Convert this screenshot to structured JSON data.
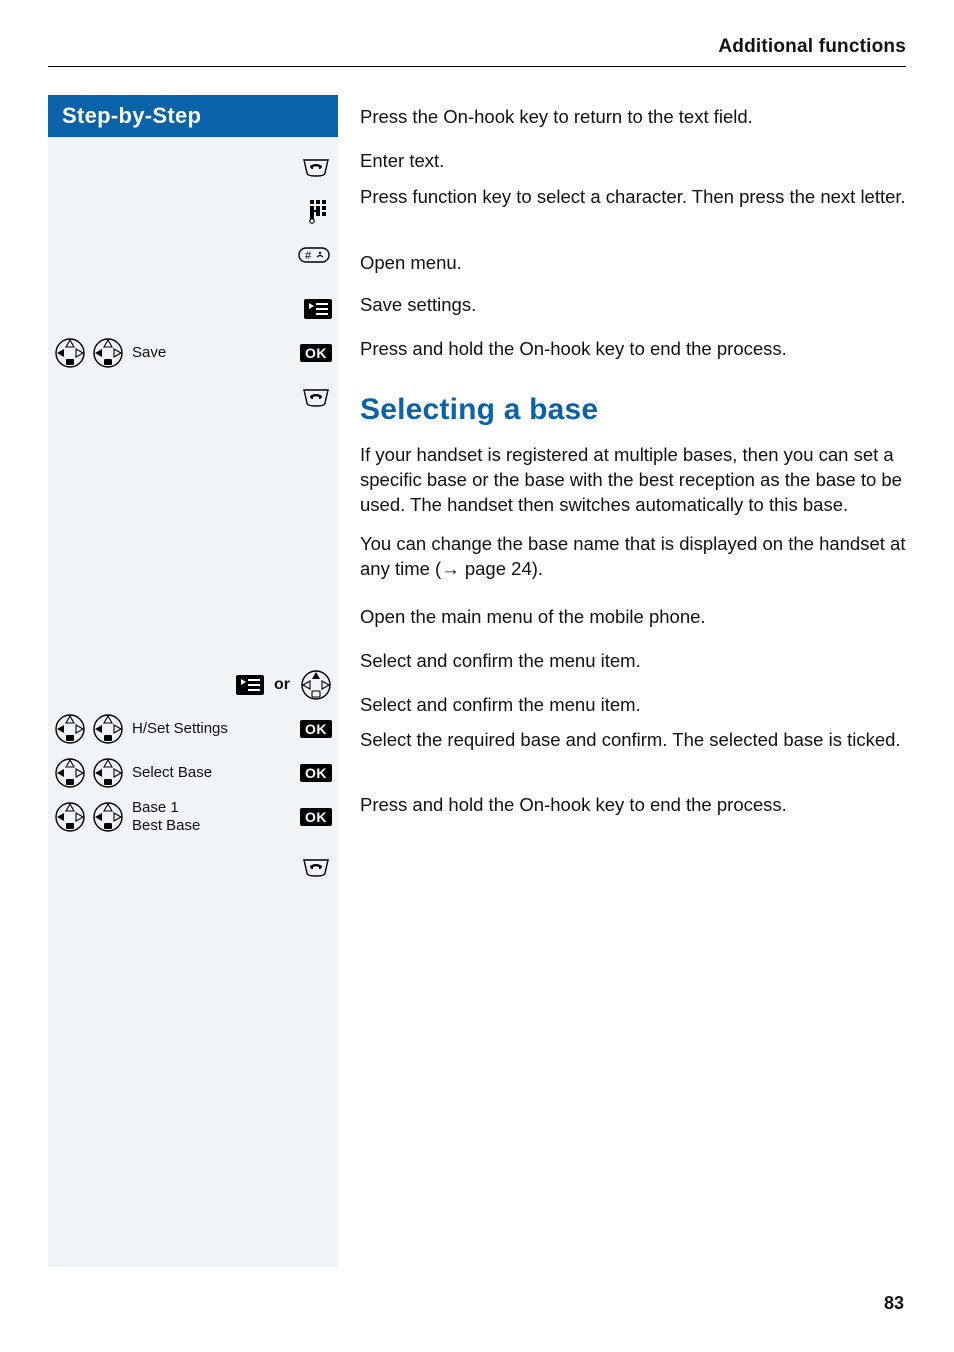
{
  "header": {
    "running": "Additional functions"
  },
  "left": {
    "title": "Step-by-Step",
    "save_label": "Save",
    "or_word": "or",
    "hset_label": "H/Set Settings",
    "select_base_label": "Select Base",
    "base_option_line1": "Base 1",
    "base_option_line2": "Best Base",
    "ok": "OK"
  },
  "right": {
    "step1": "Press the On-hook key to return to the text field.",
    "step2": "Enter text.",
    "step3": "Press function key to select a character. Then press the next letter.",
    "step4": "Open menu.",
    "step5": "Save settings.",
    "step6": "Press and hold the On-hook key to end the process.",
    "heading": "Selecting a base",
    "para1": "If your handset is registered at multiple bases, then you can set a specific base or the base with the best reception as the base to be used. The handset then switches automatically to this base.",
    "para2_a": "You can change the base name that is displayed on the handset at any time (",
    "para2_arrow": "→",
    "para2_b": " page 24).",
    "step7": "Open the main menu of the mobile phone.",
    "step8": "Select and confirm the menu item.",
    "step9": "Select and confirm the menu item.",
    "step10": "Select the required base and confirm. The selected base is ticked.",
    "step11": "Press and hold the On-hook key to end the process."
  },
  "page_number": "83"
}
